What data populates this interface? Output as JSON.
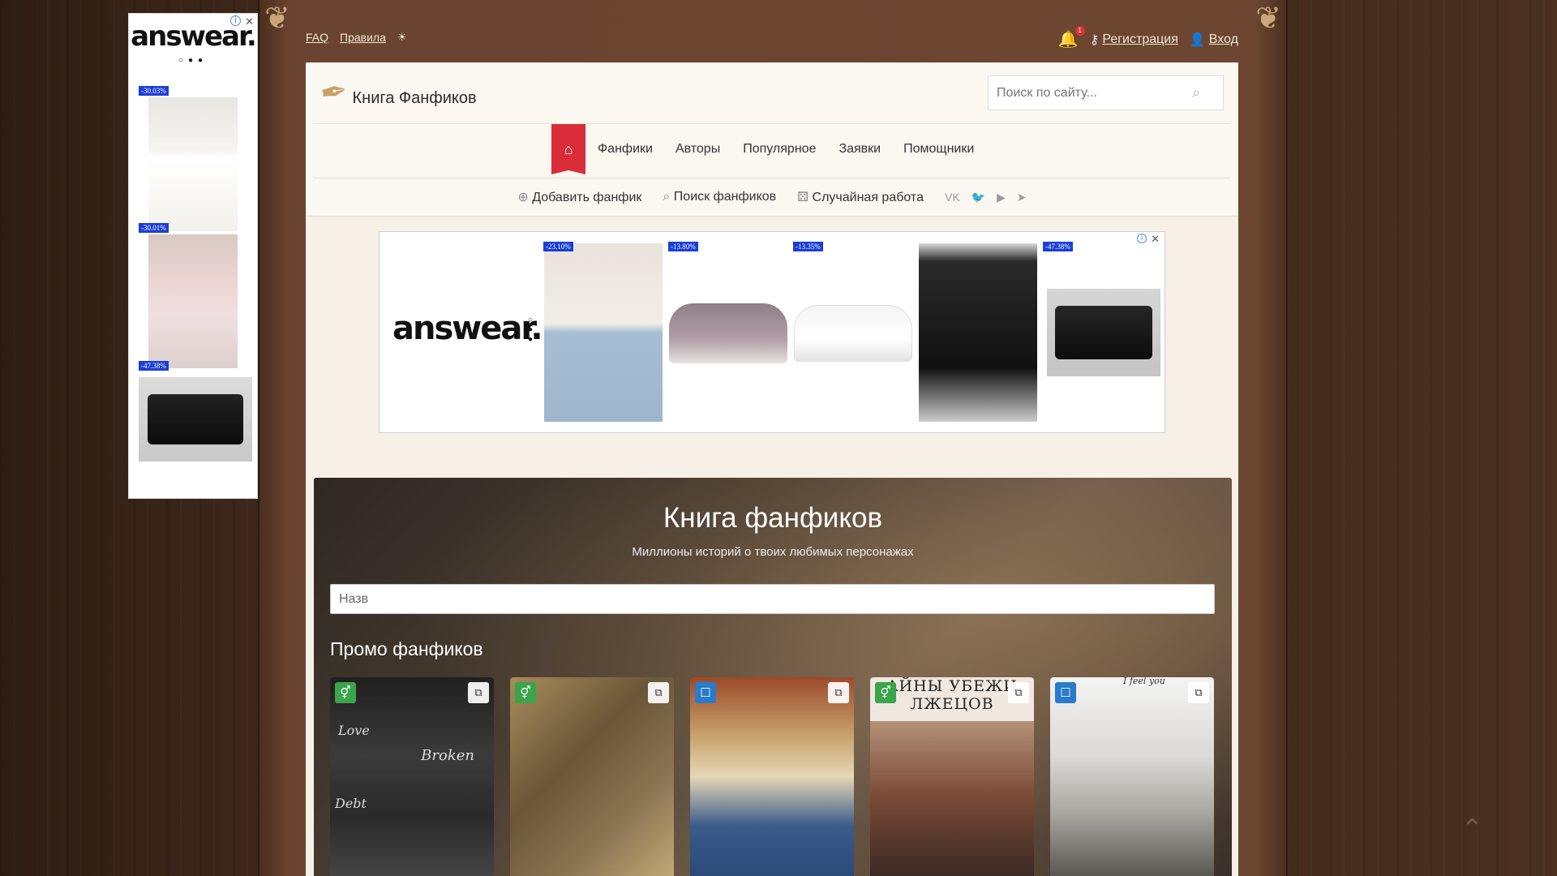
{
  "side_ad": {
    "brand": "answear.",
    "discounts": [
      "-30.03%",
      "-30.01%",
      "-47.38%"
    ]
  },
  "topbar": {
    "faq": "FAQ",
    "rules": "Правила",
    "notifications_count": "1",
    "register": "Регистрация",
    "login": "Вход"
  },
  "header": {
    "logo_text": "Книга Фанфиков",
    "search_placeholder": "Поиск по сайту..."
  },
  "nav": {
    "items": [
      "Фанфики",
      "Авторы",
      "Популярное",
      "Заявки",
      "Помощники"
    ]
  },
  "subnav": {
    "add": "Добавить фанфик",
    "search": "Поиск фанфиков",
    "random": "Случайная работа"
  },
  "banner_ad": {
    "brand": "answear.",
    "discounts": [
      "-23.10%",
      "-13.80%",
      "-13.35%",
      "-47.38%"
    ]
  },
  "hero": {
    "title": "Книга фанфиков",
    "tagline": "Миллионы историй о твоих любимых персонажах",
    "input_value": "Назв",
    "promo_title": "Промо фанфиков"
  },
  "cards": [
    {
      "badge": "green",
      "cover_text": [
        "Love",
        "Broken",
        "Debt"
      ]
    },
    {
      "badge": "green",
      "cover_text": []
    },
    {
      "badge": "blue",
      "cover_text": []
    },
    {
      "badge": "green",
      "cover_text": [
        "АЙНЫ УБЕЖИ",
        "ЛЖЕЦОВ"
      ]
    },
    {
      "badge": "blue",
      "cover_text": [
        "I feel you"
      ]
    }
  ],
  "colors": {
    "accent": "#d92d3a",
    "badge_green": "#3aa54a",
    "badge_blue": "#2a7bc9",
    "ad_discount": "#1a3ed8"
  }
}
